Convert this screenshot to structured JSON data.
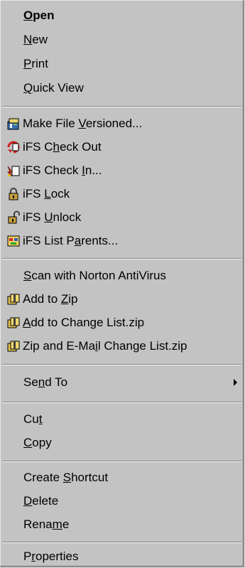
{
  "menu": {
    "items": [
      {
        "pre": "",
        "u": "O",
        "post": "pen"
      },
      {
        "pre": "",
        "u": "N",
        "post": "ew"
      },
      {
        "pre": "",
        "u": "P",
        "post": "rint"
      },
      {
        "pre": "",
        "u": "Q",
        "post": "uick View"
      },
      {
        "pre": "Make File ",
        "u": "V",
        "post": "ersioned...",
        "icon": "versioned-file-icon"
      },
      {
        "pre": "iFS C",
        "u": "h",
        "post": "eck Out",
        "icon": "check-out-icon"
      },
      {
        "pre": "iFS Check ",
        "u": "I",
        "post": "n...",
        "icon": "check-in-icon"
      },
      {
        "pre": "iFS ",
        "u": "L",
        "post": "ock",
        "icon": "lock-icon"
      },
      {
        "pre": "iFS ",
        "u": "U",
        "post": "nlock",
        "icon": "unlock-icon"
      },
      {
        "pre": "iFS List P",
        "u": "a",
        "post": "rents...",
        "icon": "list-parents-icon"
      },
      {
        "pre": "",
        "u": "S",
        "post": "can with Norton AntiVirus"
      },
      {
        "pre": "Add to ",
        "u": "Z",
        "post": "ip",
        "icon": "zip-icon"
      },
      {
        "pre": "",
        "u": "A",
        "post": "dd to Change List.zip",
        "icon": "zip-icon"
      },
      {
        "pre": "Zip and E-Ma",
        "u": "i",
        "post": "l Change List.zip",
        "icon": "zip-mail-icon"
      },
      {
        "pre": "Se",
        "u": "n",
        "post": "d To"
      },
      {
        "pre": "Cu",
        "u": "t",
        "post": ""
      },
      {
        "pre": "",
        "u": "C",
        "post": "opy"
      },
      {
        "pre": "Create ",
        "u": "S",
        "post": "hortcut"
      },
      {
        "pre": "",
        "u": "D",
        "post": "elete"
      },
      {
        "pre": "Rena",
        "u": "m",
        "post": "e"
      },
      {
        "pre": "P",
        "u": "r",
        "post": "operties"
      }
    ]
  }
}
